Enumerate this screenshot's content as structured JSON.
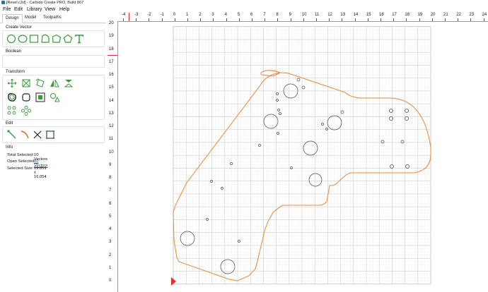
{
  "window": {
    "title": "[Revel.c2d] - Carbide Create PRO, Build 807"
  },
  "menu": {
    "file": "File",
    "edit": "Edit",
    "library": "Library",
    "view": "View",
    "help": "Help"
  },
  "tabs": {
    "design": "Design",
    "model": "Model",
    "toolpaths": "Toolpaths"
  },
  "sections": {
    "create_vector": "Create Vector",
    "boolean": "Boolean",
    "transform": "Transform",
    "edit": "Edit",
    "info": "Info"
  },
  "info": {
    "total_selected_label": "Total Selected:",
    "total_selected_value": "10 Vectors",
    "open_selected_label": "Open Selected:",
    "open_selected_value": "10 Vectors",
    "selected_size_label": "Selected Size:",
    "selected_size_value": "19.851 x 16.054"
  },
  "colors": {
    "accent_green": "#3a9a3a",
    "toolpath_orange": "#e8883a",
    "grid": "#e4e4e4",
    "ruler_marker": "#e03030"
  },
  "rulers": {
    "x": [
      "-4",
      "-3",
      "-2",
      "-1",
      "0",
      "1",
      "2",
      "3",
      "4",
      "5",
      "6",
      "7",
      "8",
      "9",
      "10",
      "11",
      "12",
      "13",
      "14",
      "15",
      "16",
      "17",
      "18",
      "19",
      "20",
      "21",
      "22",
      "23",
      "24"
    ],
    "y": [
      "20",
      "19",
      "18",
      "17",
      "16",
      "15",
      "14",
      "13",
      "12",
      "11",
      "10",
      "9",
      "8",
      "7",
      "6",
      "5",
      "4",
      "3",
      "2",
      "1",
      "0"
    ]
  }
}
